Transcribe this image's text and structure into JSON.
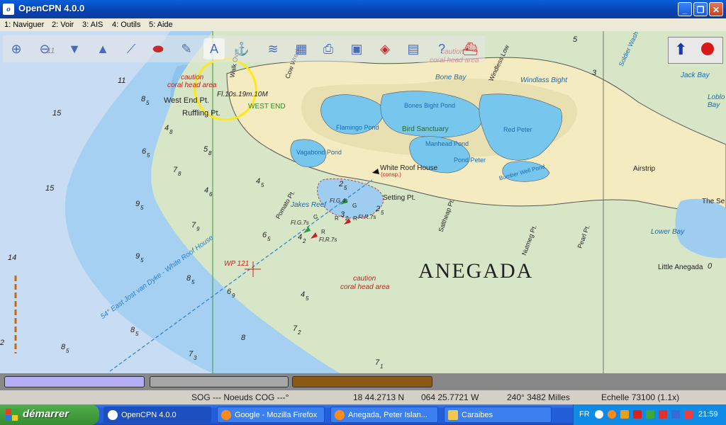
{
  "window": {
    "title": "OpenCPN 4.0.0",
    "app_icon": "opencpn-icon"
  },
  "menu": {
    "items": [
      "1: Naviguer",
      "2: Voir",
      "3: AIS",
      "4: Outils",
      "5: Aide"
    ]
  },
  "toolbar": {
    "icons": [
      "zoom-in-icon",
      "zoom-out-icon",
      "scale-down-icon",
      "scale-up-icon",
      "route-icon",
      "track-icon",
      "settings-icon",
      "measure-icon",
      "tide-icon",
      "current-icon",
      "chart-icon",
      "print-icon",
      "ais-icon",
      "help-icon",
      "mob-icon",
      "color-scheme-icon"
    ]
  },
  "chart": {
    "place_main": "ANEGADA",
    "labels": {
      "west_end_pt": "West End Pt.",
      "ruffling_pt": "Ruffling Pt.",
      "west_end": "WEST END",
      "light_west": "Fl.10s.19m.10M",
      "caution_top": "caution",
      "coral_top": "coral head area",
      "caution_mid": "caution",
      "coral_mid": "coral head area",
      "caution_right": "caution",
      "coral_right": "coral head area",
      "flamingo_pond": "Flamingo Pond",
      "bones_bight_pond": "Bones Bight Pond",
      "bird_sanctuary": "Bird Sanctuary",
      "manhead_pond": "Manhead Pond",
      "red_peter": "Red Peter",
      "pond_peter": "Pond Peter",
      "vagabond_pond": "Vagabond Pond",
      "bumber_well": "Bumber Well Pond",
      "white_roof_house": "White Roof House",
      "consp": "(consp.)",
      "setting_pt": "Setting Pt.",
      "jakes_reef": "Jakes Reef",
      "pomato_pt": "Pomato Pt.",
      "saltheap_pt": "Saltheap Pt.",
      "nutmeg_pt": "Nutmeg Pt.",
      "pearl_pt": "Pearl Pt.",
      "airstrip": "Airstrip",
      "the_settlement": "The Se",
      "lower_bay": "Lower Bay",
      "little_anegada": "Little Anegada",
      "bone_bay": "Bone Bay",
      "windlass_bight": "Windlass Bight",
      "jack_bay": "Jack Bay",
      "loblolly": "Loblo Bay",
      "windless_low": "Windless Low",
      "soldier_wash": "Soldier Wash",
      "cow_wreck": "Cow Wreck",
      "walk_over": "Walk Over",
      "wp121": "WP 121",
      "route_line": "54° East Jost van Dyke - White Roof House",
      "fl_g_4s": "Fl.G.4s",
      "fl_r_7s_a": "Fl.R.7s",
      "fl_g_7s": "Fl.G.7s",
      "fl_r_7s_b": "Fl.R.7s",
      "buoy_g": "G",
      "buoy_r": "R",
      "buoy_r2": "R",
      "buoy_r3": "R",
      "buoy_g2": "G"
    },
    "soundings": [
      {
        "v": "11",
        "r": "11"
      },
      {
        "v": "11",
        "r": "11b"
      },
      {
        "v": "15",
        "r": "15a"
      },
      {
        "v": "15",
        "r": "15b"
      },
      {
        "v": "8",
        "s": "5",
        "r": "85a"
      },
      {
        "v": "4",
        "s": "8",
        "r": "48"
      },
      {
        "v": "6",
        "s": "5",
        "r": "65a"
      },
      {
        "v": "7",
        "s": "8",
        "r": "78"
      },
      {
        "v": "5",
        "s": "8",
        "r": "58"
      },
      {
        "v": "4",
        "s": "6",
        "r": "46"
      },
      {
        "v": "9",
        "s": "5",
        "r": "95a"
      },
      {
        "v": "7",
        "s": "9",
        "r": "79"
      },
      {
        "v": "9",
        "s": "5",
        "r": "95b"
      },
      {
        "v": "6",
        "s": "5",
        "r": "65b"
      },
      {
        "v": "14",
        "r": "14"
      },
      {
        "v": "8",
        "s": "5",
        "r": "85b"
      },
      {
        "v": "6",
        "s": "9",
        "r": "69"
      },
      {
        "v": "8",
        "s": "5",
        "r": "85c"
      },
      {
        "v": "8",
        "s": "5",
        "r": "85d"
      },
      {
        "v": "7",
        "s": "3",
        "r": "73"
      },
      {
        "v": "7",
        "s": "2",
        "r": "72"
      },
      {
        "v": "8",
        "r": "8"
      },
      {
        "v": "7",
        "s": "1",
        "r": "71"
      },
      {
        "v": "4",
        "s": "5",
        "r": "45a"
      },
      {
        "v": "4",
        "s": "5",
        "r": "45b"
      },
      {
        "v": "2",
        "s": "5",
        "r": "25a"
      },
      {
        "v": "2",
        "s": "5",
        "r": "25b"
      },
      {
        "v": "3",
        "s": "2",
        "r": "32"
      },
      {
        "v": "4",
        "s": "2",
        "r": "42"
      },
      {
        "v": "2",
        "r": "2"
      },
      {
        "v": "5",
        "r": "5"
      },
      {
        "v": "0",
        "r": "0"
      },
      {
        "v": "3",
        "r": "3"
      }
    ]
  },
  "progress": {
    "bars": [
      {
        "color": "#b3aef5",
        "fill": 1.0
      },
      {
        "color": "#a6a6a6",
        "fill": 1.0
      },
      {
        "color": "#8b5a14",
        "fill": 1.0
      }
    ]
  },
  "status": {
    "sog": "SOG --- Noeuds COG ---°",
    "lat": "18 44.2713 N",
    "lon": "064 25.7721 W",
    "bearing": "240°  3482 Milles",
    "scale": "Echelle 73100 (1.1x)"
  },
  "taskbar": {
    "start": "démarrer",
    "tasks": [
      {
        "label": "OpenCPN 4.0.0",
        "active": true,
        "color": "#ffffff"
      },
      {
        "label": "Google - Mozilla Firefox",
        "active": false,
        "color": "#ff8a1a"
      },
      {
        "label": "Anegada, Peter Islan...",
        "active": false,
        "color": "#ff8a1a"
      },
      {
        "label": "Caraibes",
        "active": false,
        "color": "#f0c850"
      }
    ],
    "lang": "FR",
    "clock": "21:59"
  },
  "colors": {
    "deep": "#c8dcf4",
    "shallow": "#9fcdf0",
    "land": "#f5ebc0",
    "marsh": "#d8e6c8",
    "pond": "#77c6ee",
    "accent": "#c8201c"
  }
}
